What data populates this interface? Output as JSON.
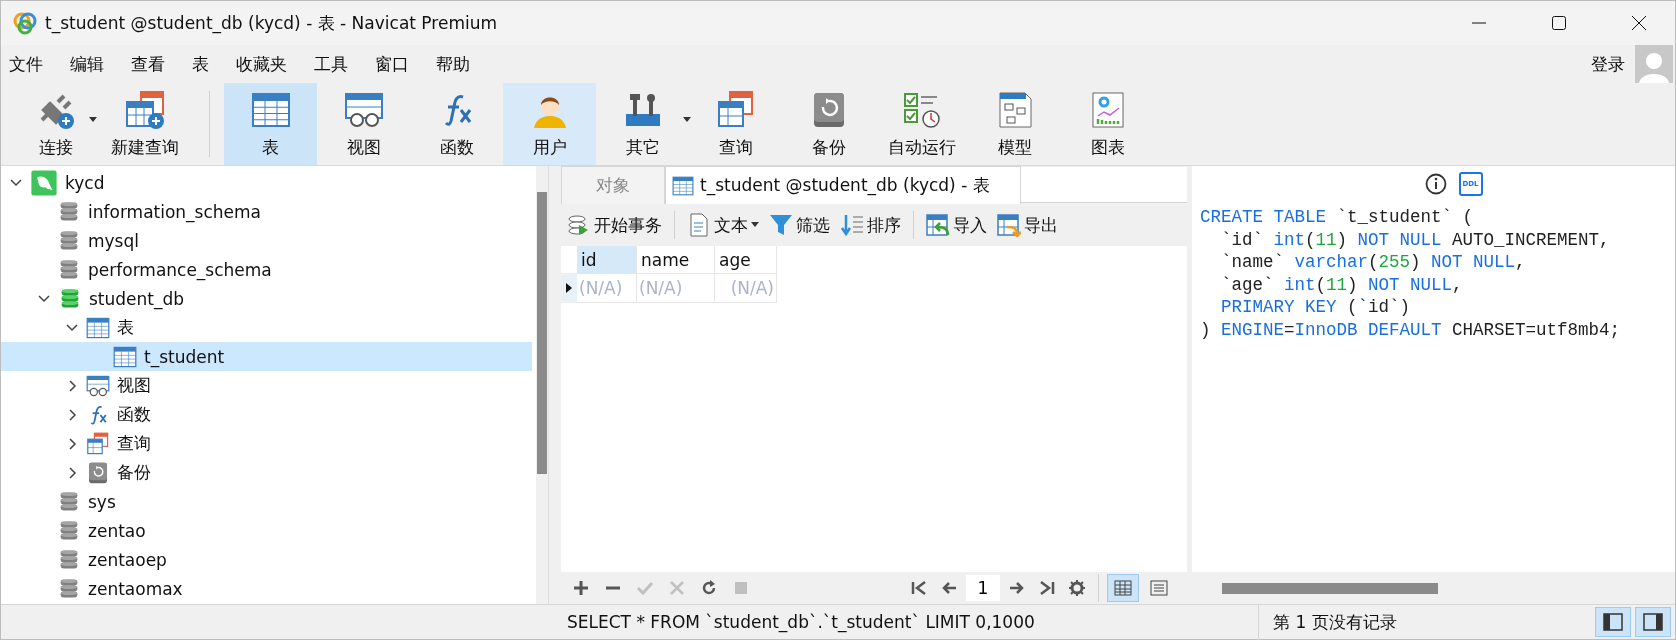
{
  "window": {
    "title": "t_student @student_db (kycd) - 表 - Navicat Premium"
  },
  "menu": [
    "文件",
    "编辑",
    "查看",
    "表",
    "收藏夹",
    "工具",
    "窗口",
    "帮助"
  ],
  "account": {
    "label": "登录"
  },
  "toolbar": [
    {
      "label": "连接",
      "dropdown": true,
      "selected": false,
      "hovered": false
    },
    {
      "label": "新建查询",
      "dropdown": false,
      "selected": false,
      "hovered": false
    },
    {
      "label": "表",
      "dropdown": false,
      "selected": true,
      "hovered": false
    },
    {
      "label": "视图",
      "dropdown": false,
      "selected": false,
      "hovered": false
    },
    {
      "label": "函数",
      "dropdown": false,
      "selected": false,
      "hovered": false
    },
    {
      "label": "用户",
      "dropdown": false,
      "selected": false,
      "hovered": true
    },
    {
      "label": "其它",
      "dropdown": true,
      "selected": false,
      "hovered": false
    },
    {
      "label": "查询",
      "dropdown": false,
      "selected": false,
      "hovered": false
    },
    {
      "label": "备份",
      "dropdown": false,
      "selected": false,
      "hovered": false
    },
    {
      "label": "自动运行",
      "dropdown": false,
      "selected": false,
      "hovered": false
    },
    {
      "label": "模型",
      "dropdown": false,
      "selected": false,
      "hovered": false
    },
    {
      "label": "图表",
      "dropdown": false,
      "selected": false,
      "hovered": false
    }
  ],
  "tree": [
    {
      "label": "kycd",
      "kind": "server",
      "expanded": true,
      "selected": false,
      "children": [
        {
          "label": "information_schema",
          "kind": "database",
          "selected": false
        },
        {
          "label": "mysql",
          "kind": "database",
          "selected": false
        },
        {
          "label": "performance_schema",
          "kind": "database",
          "selected": false
        },
        {
          "label": "student_db",
          "kind": "database-open",
          "expanded": true,
          "selected": false,
          "children": [
            {
              "label": "表",
              "kind": "table",
              "expanded": true,
              "selected": false,
              "children": [
                {
                  "label": "t_student",
                  "kind": "table",
                  "selected": true
                }
              ]
            },
            {
              "label": "视图",
              "kind": "view",
              "expanded": false,
              "selected": false
            },
            {
              "label": "函数",
              "kind": "function",
              "expanded": false,
              "selected": false
            },
            {
              "label": "查询",
              "kind": "query",
              "expanded": false,
              "selected": false
            },
            {
              "label": "备份",
              "kind": "backup",
              "expanded": false,
              "selected": false
            }
          ]
        },
        {
          "label": "sys",
          "kind": "database",
          "selected": false
        },
        {
          "label": "zentao",
          "kind": "database",
          "selected": false
        },
        {
          "label": "zentaoep",
          "kind": "database",
          "selected": false
        },
        {
          "label": "zentaomax",
          "kind": "database",
          "selected": false
        }
      ]
    }
  ],
  "tabs": [
    {
      "label": "对象",
      "kind": "object",
      "selected": false
    },
    {
      "label": "t_student @student_db (kycd) - 表",
      "kind": "table",
      "selected": true
    }
  ],
  "table_toolbar": [
    {
      "label": "开始事务",
      "dropdown": false
    },
    {
      "label": "文本",
      "dropdown": true
    },
    {
      "label": "筛选",
      "dropdown": false
    },
    {
      "label": "排序",
      "dropdown": false
    },
    {
      "label": "导入",
      "dropdown": false
    },
    {
      "label": "导出",
      "dropdown": false
    }
  ],
  "grid": {
    "columns": [
      {
        "label": "id",
        "selected": true
      },
      {
        "label": "name",
        "selected": false
      },
      {
        "label": "age",
        "selected": false
      }
    ],
    "rows": [
      {
        "current": true,
        "cells": [
          "(N/A)",
          "(N/A)",
          "(N/A)"
        ]
      }
    ]
  },
  "record_bar": {
    "actions": [
      {
        "disabled": false
      },
      {
        "disabled": false
      },
      {
        "disabled": true
      },
      {
        "disabled": true
      },
      {
        "disabled": false
      },
      {
        "disabled": true
      }
    ],
    "page": "1",
    "views": [
      {
        "selected": true
      },
      {
        "selected": false
      }
    ]
  },
  "ddl": {
    "buttons": [
      {
        "selected": false
      },
      {
        "label": "DDL",
        "selected": true
      }
    ],
    "lines": [
      [
        {
          "text": "CREATE TABLE",
          "kind": "keyword"
        },
        {
          "text": " `t_student` (",
          "kind": "plain"
        }
      ],
      [
        {
          "text": "  `id` ",
          "kind": "plain"
        },
        {
          "text": "int",
          "kind": "keyword"
        },
        {
          "text": "(",
          "kind": "plain"
        },
        {
          "text": "11",
          "kind": "number"
        },
        {
          "text": ") ",
          "kind": "plain"
        },
        {
          "text": "NOT NULL",
          "kind": "keyword"
        },
        {
          "text": " AUTO_INCREMENT,",
          "kind": "plain"
        }
      ],
      [
        {
          "text": "  `name` ",
          "kind": "plain"
        },
        {
          "text": "varchar",
          "kind": "keyword"
        },
        {
          "text": "(",
          "kind": "plain"
        },
        {
          "text": "255",
          "kind": "number"
        },
        {
          "text": ") ",
          "kind": "plain"
        },
        {
          "text": "NOT NULL",
          "kind": "keyword"
        },
        {
          "text": ",",
          "kind": "plain"
        }
      ],
      [
        {
          "text": "  `age` ",
          "kind": "plain"
        },
        {
          "text": "int",
          "kind": "keyword"
        },
        {
          "text": "(",
          "kind": "plain"
        },
        {
          "text": "11",
          "kind": "number"
        },
        {
          "text": ") ",
          "kind": "plain"
        },
        {
          "text": "NOT NULL",
          "kind": "keyword"
        },
        {
          "text": ",",
          "kind": "plain"
        }
      ],
      [
        {
          "text": "  PRIMARY KEY",
          "kind": "keyword"
        },
        {
          "text": " (`id`)",
          "kind": "plain"
        }
      ],
      [
        {
          "text": ") ",
          "kind": "plain"
        },
        {
          "text": "ENGINE",
          "kind": "keyword"
        },
        {
          "text": "=",
          "kind": "plain"
        },
        {
          "text": "InnoDB",
          "kind": "keyword"
        },
        {
          "text": " DEFAULT",
          "kind": "keyword"
        },
        {
          "text": " CHARSET=utf8mb4;",
          "kind": "plain"
        }
      ]
    ]
  },
  "status_bar": {
    "query": "SELECT * FROM `student_db`.`t_student` LIMIT 0,1000",
    "records": "第 1 页没有记录",
    "panes": [
      {
        "selected": true
      },
      {
        "selected": true
      }
    ]
  }
}
